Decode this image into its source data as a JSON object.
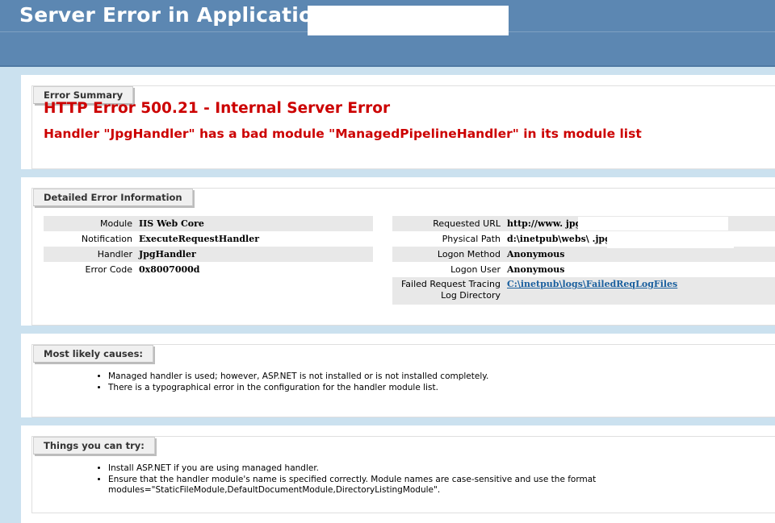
{
  "header": {
    "title": "Server Error in Application \"                                            \""
  },
  "summary": {
    "tab_label": "Error Summary",
    "heading": "HTTP Error 500.21 - Internal Server Error",
    "subheading": "Handler \"JpgHandler\" has a bad module \"ManagedPipelineHandler\" in its module list"
  },
  "detail": {
    "tab_label": "Detailed Error Information",
    "left": [
      {
        "label": "Module",
        "value": "IIS Web Core"
      },
      {
        "label": "Notification",
        "value": "ExecuteRequestHandler"
      },
      {
        "label": "Handler",
        "value": "JpgHandler"
      },
      {
        "label": "Error Code",
        "value": "0x8007000d"
      }
    ],
    "right": [
      {
        "label": "Requested URL",
        "value": "http://www.                                 jpg"
      },
      {
        "label": "Physical Path",
        "value": "d:\\inetpub\\webs\\                                   .jpg"
      },
      {
        "label": "Logon Method",
        "value": "Anonymous"
      },
      {
        "label": "Logon User",
        "value": "Anonymous"
      },
      {
        "label_line1": "Failed Request Tracing",
        "label_line2": "Log Directory",
        "value": "C:\\inetpub\\logs\\FailedReqLogFiles"
      }
    ]
  },
  "causes": {
    "tab_label": "Most likely causes:",
    "items": [
      "Managed handler is used; however, ASP.NET is not installed or is not installed completely.",
      "There is a typographical error in the configuration for the handler module list."
    ]
  },
  "try": {
    "tab_label": "Things you can try:",
    "items": [
      "Install ASP.NET if you are using managed handler.",
      "Ensure that the handler module's name is specified correctly. Module names are case-sensitive and use the format modules=\"StaticFileModule,DefaultDocumentModule,DirectoryListingModule\"."
    ]
  }
}
